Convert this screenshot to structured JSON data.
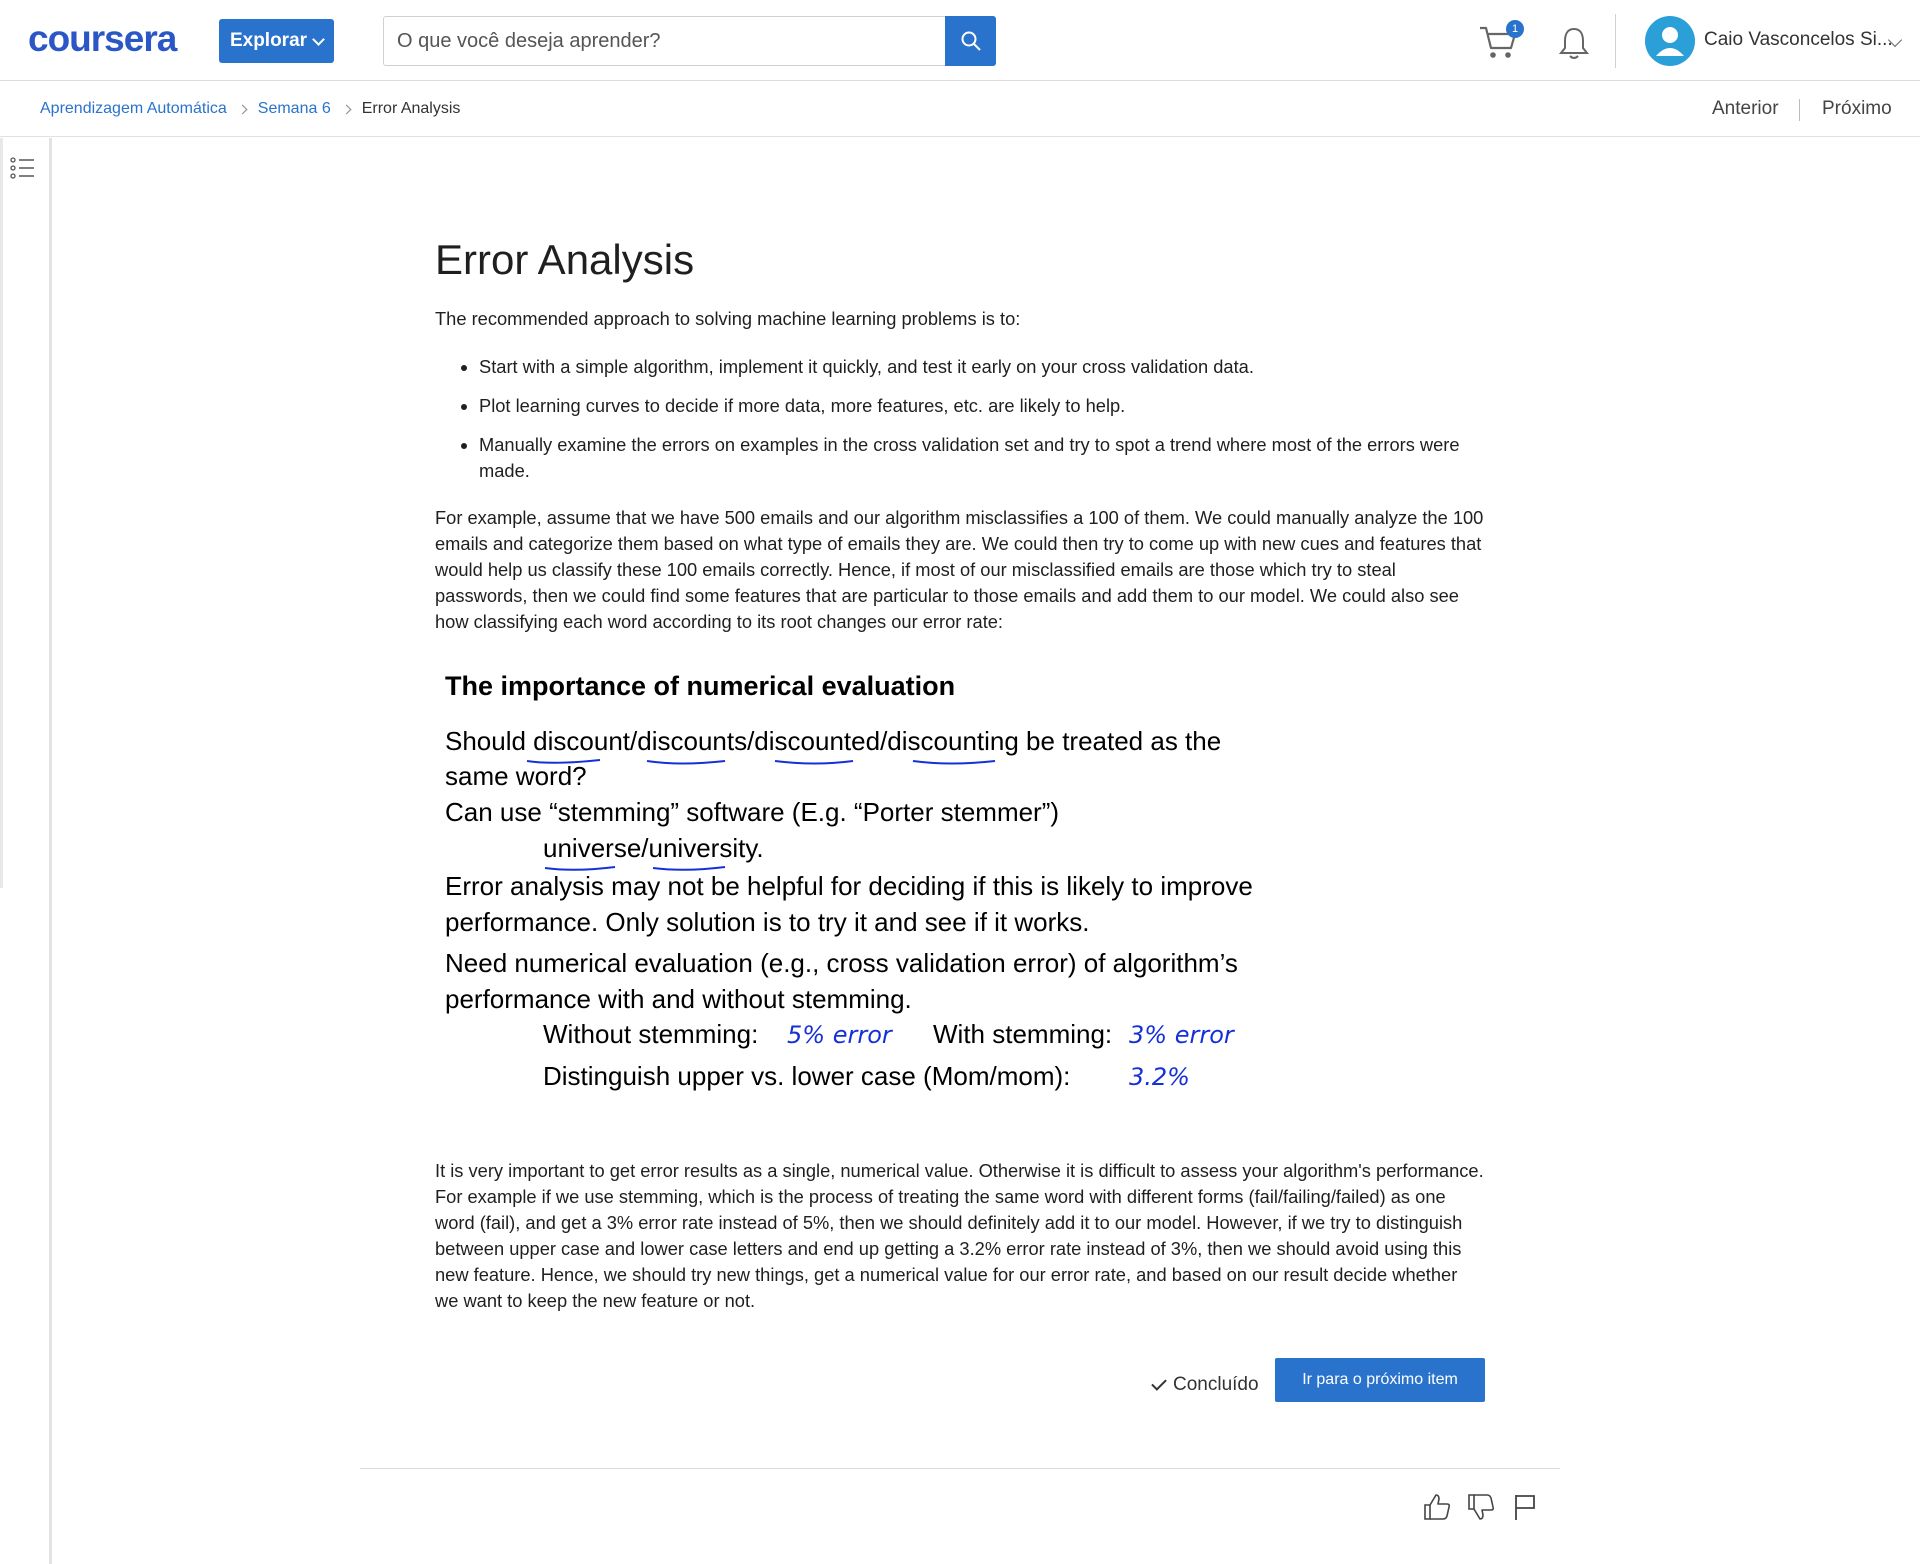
{
  "header": {
    "logo": "coursera",
    "explore_label": "Explorar",
    "search_placeholder": "O que você deseja aprender?",
    "cart_count": "1",
    "user_name": "Caio Vasconcelos Si..."
  },
  "breadcrumb": {
    "items": [
      "Aprendizagem Automática",
      "Semana 6",
      "Error Analysis"
    ]
  },
  "nav": {
    "prev": "Anterior",
    "next": "Próximo"
  },
  "content": {
    "title": "Error Analysis",
    "intro": "The recommended approach to solving machine learning problems is to:",
    "bullets": [
      "Start with a simple algorithm, implement it quickly, and test it early on your cross validation data.",
      "Plot learning curves to decide if more data, more features, etc. are likely to help.",
      "Manually examine the errors on examples in the cross validation set and try to spot a trend where most of the errors were made."
    ],
    "para2": "For example, assume that we have 500 emails and our algorithm misclassifies a 100 of them. We could manually analyze the 100 emails and categorize them based on what type of emails they are. We could then try to come up with new cues and features that would help us classify these 100 emails correctly. Hence, if most of our misclassified emails are those which try to steal passwords, then we could find some features that are particular to those emails and add them to our model. We could also see how classifying each word according to its root changes our error rate:",
    "slide": {
      "title": "The importance of numerical evaluation",
      "line1": "Should discount/discounts/discounted/discounting  be treated as the",
      "line2": "same word?",
      "line3": "Can use “stemming” software (E.g. “Porter stemmer”)",
      "line4": "universe/university.",
      "line5": "Error analysis may not be helpful for deciding if this is likely to improve",
      "line6": "performance. Only solution is to try it and see if it works.",
      "line7": "Need numerical evaluation (e.g., cross validation error) of algorithm’s",
      "line8": "performance with and without stemming.",
      "line9a": "Without stemming:",
      "hand1": "5% error",
      "line9b": "With stemming:",
      "hand2": "3% error",
      "line10": "Distinguish upper vs. lower case (Mom/mom):",
      "hand3": "3.2%"
    },
    "para3": "It is very important to get error results as a single, numerical value. Otherwise it is difficult to assess your algorithm's performance. For example if we use stemming, which is the process of treating the same word with different forms (fail/failing/failed) as one word (fail), and get a 3% error rate instead of 5%, then we should definitely add it to our model. However, if we try to distinguish between upper case and lower case letters and end up getting a 3.2% error rate instead of 3%, then we should avoid using this new feature. Hence, we should try new things, get a numerical value for our error rate, and based on our result decide whether we want to keep the new feature or not.",
    "done_label": "Concluído",
    "next_item_label": "Ir para o próximo item"
  },
  "colors": {
    "brand_blue": "#2a73cc",
    "logo_blue": "#2a56c6",
    "handwriting_blue": "#1530d6"
  },
  "icons": [
    "search-icon",
    "cart-icon",
    "bell-icon",
    "avatar-icon",
    "list-toggle-icon",
    "thumbs-up-icon",
    "thumbs-down-icon",
    "flag-icon"
  ]
}
